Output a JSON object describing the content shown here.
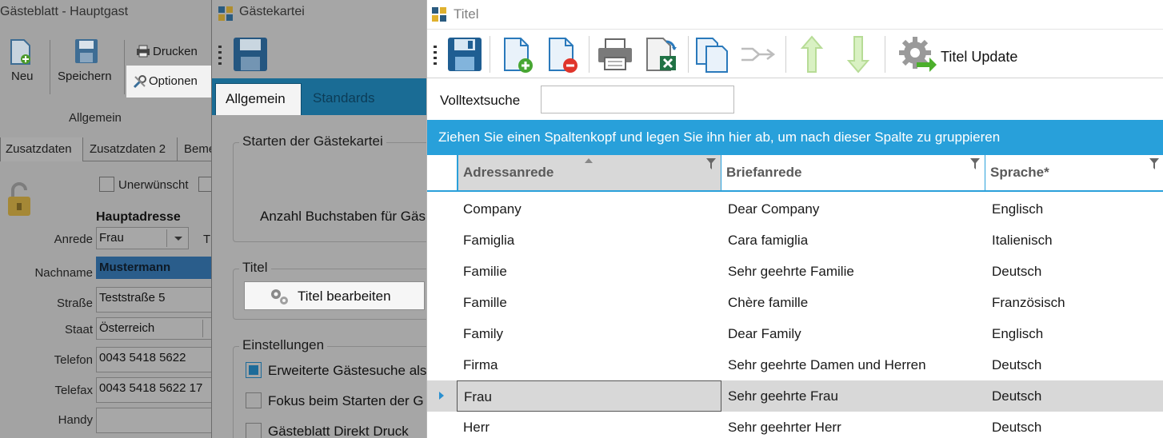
{
  "gaesteblatt": {
    "title": "Gästeblatt - Hauptgast",
    "ribbon": {
      "neu": "Neu",
      "speichern": "Speichern",
      "drucken": "Drucken",
      "optionen": "Optionen",
      "group_label": "Allgemein"
    },
    "tabs": [
      "Zusatzdaten",
      "Zusatzdaten 2",
      "Beme"
    ],
    "checkbox_unerwuenscht": "Unerwünscht",
    "section_title": "Hauptadresse",
    "fields": {
      "anrede_label": "Anrede",
      "anrede_value": "Frau",
      "nachname_label": "Nachname",
      "nachname_value": "Mustermann",
      "strasse_label": "Straße",
      "strasse_value": "Teststraße 5",
      "staat_label": "Staat",
      "staat_value": "Österreich",
      "telefon_label": "Telefon",
      "telefon_value": "0043 5418 5622",
      "telefax_label": "Telefax",
      "telefax_value": "0043 5418 5622 17",
      "handy_label": "Handy",
      "handy_value": ""
    },
    "cut_label": "T"
  },
  "gaestekartei": {
    "title": "Gästekartei",
    "tabs": [
      "Allgemein",
      "Standards"
    ],
    "group_start": {
      "title": "Starten der Gästekartei",
      "text": "Anzahl Buchstaben für Gäs"
    },
    "group_titel": {
      "title": "Titel",
      "button": "Titel bearbeiten"
    },
    "group_einstellungen": {
      "title": "Einstellungen",
      "options": [
        {
          "label": "Erweiterte Gästesuche als",
          "checked": true
        },
        {
          "label": "Fokus beim Starten der G",
          "checked": false
        },
        {
          "label": "Gästeblatt Direkt Druck",
          "checked": false
        }
      ]
    }
  },
  "titel": {
    "title": "Titel",
    "toolbar": {
      "save_icon": "save-icon",
      "update_label": "Titel Update"
    },
    "search_label": "Volltextsuche",
    "search_value": "",
    "group_hint": "Ziehen Sie einen Spaltenkopf und legen Sie ihn hier ab, um nach dieser Spalte zu gruppieren",
    "columns": [
      "Adressanrede",
      "Briefanrede",
      "Sprache*"
    ],
    "rows": [
      [
        "Company",
        "Dear Company",
        "Englisch"
      ],
      [
        "Famiglia",
        "Cara famiglia",
        "Italienisch"
      ],
      [
        "Familie",
        "Sehr geehrte Familie",
        "Deutsch"
      ],
      [
        "Famille",
        "Chère famille",
        "Französisch"
      ],
      [
        "Family",
        "Dear Family",
        "Englisch"
      ],
      [
        "Firma",
        "Sehr geehrte Damen und Herren",
        "Deutsch"
      ],
      [
        "Frau",
        "Sehr geehrte Frau",
        "Deutsch"
      ],
      [
        "Herr",
        "Sehr geehrter Herr",
        "Deutsch"
      ]
    ],
    "selected_row": 6
  }
}
